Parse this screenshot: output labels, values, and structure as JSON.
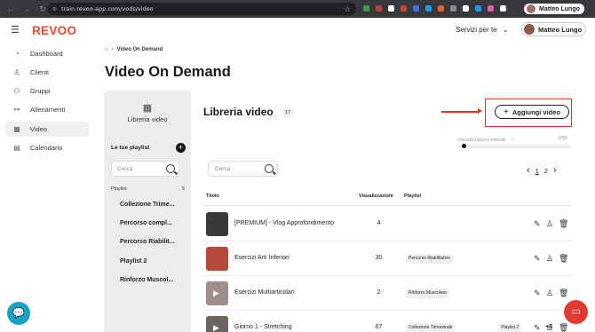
{
  "browser": {
    "url": "train.revoo-app.com/vods/video",
    "profile": "Matteo Lungo",
    "back": "←",
    "forward": "→",
    "reload": "↻",
    "star": "☆",
    "ext_colors": [
      "#3a9b45",
      "#c23b3b",
      "#ffffff",
      "#c24a28",
      "#4a6fd6",
      "#1d9bf0",
      "#e0632a",
      "#8a8a8a",
      "#ffffff",
      "#1d9bf0",
      "#e05db4",
      "#ffffff"
    ]
  },
  "app": {
    "logo": "REVOO",
    "menu_icon": "☰",
    "servizi": "Servizi per te",
    "servizi_chev": "⌄",
    "user": "Matteo Lungo"
  },
  "sidebar": {
    "items": [
      {
        "label": "Dashboard",
        "icon": "◔"
      },
      {
        "label": "Clienti",
        "icon": "♙"
      },
      {
        "label": "Gruppi",
        "icon": "⚇"
      },
      {
        "label": "Allenamenti",
        "icon": "⚯"
      },
      {
        "label": "Video",
        "icon": "▦",
        "active": true
      },
      {
        "label": "Calendario",
        "icon": "▤"
      }
    ]
  },
  "breadcrumb": {
    "home_icon": "⌂",
    "sep": "›",
    "current": "Video On Demand"
  },
  "page": {
    "title": "Video On Demand"
  },
  "left_panel": {
    "tab_icon": "▦",
    "tab_label": "Libreria video",
    "your_playlists": "Le tue playlist",
    "add_icon": "+",
    "search_placeholder": "Cerca",
    "playlist_header": "Playlist",
    "playlist_count": "5",
    "playlists": [
      "Collezione Trime...",
      "Percorso compl...",
      "Percorso Riabilit...",
      "Playlist 2",
      "Rinforzo Muscol..."
    ]
  },
  "library": {
    "title": "Libreria video",
    "count": "17",
    "add_button": "Aggiungi video",
    "add_icon": "+",
    "views_label": "Visualizzazioni mensili",
    "views_info": "ⓘ",
    "views_count": "2/50",
    "views_fraction": 0.04,
    "search_placeholder": "Cerca",
    "pager": {
      "prev": "‹",
      "pages": [
        "1",
        "2"
      ],
      "next": "›"
    },
    "columns": {
      "title": "Titolo",
      "views": "Visualizzazioni",
      "playlist": "Playlist"
    },
    "rows": [
      {
        "title": "[PREMIUM] - Vlog Approfondimento",
        "views": "4",
        "tags": [],
        "thumb": "#3a3a3a"
      },
      {
        "title": "Esercizi Arti Inferiori",
        "views": "30",
        "tags": [
          "Percorso Riabilitativo"
        ],
        "thumb": "#b34a3c"
      },
      {
        "title": "Esercizi Multiarticolari",
        "views": "2",
        "tags": [
          "Rinforzo Muscolare"
        ],
        "thumb": "#9c8f87"
      },
      {
        "title": "Giorno 1 - Stretching",
        "views": "67",
        "tags": [
          "Collezione Trimestrale",
          "Playlist 2"
        ],
        "more": "+3",
        "thumb": "#6a6560"
      }
    ],
    "actions": {
      "edit": "✎",
      "user": "♙",
      "delete": "🗑"
    }
  },
  "chat": {
    "left_icon": "💬",
    "right_icon": "▭"
  }
}
